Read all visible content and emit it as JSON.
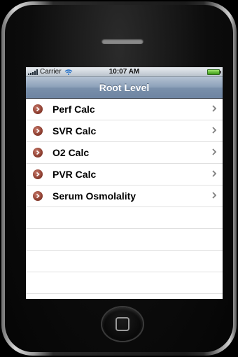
{
  "status_bar": {
    "carrier": "Carrier",
    "time": "10:07 AM"
  },
  "nav": {
    "title": "Root Level"
  },
  "items": [
    {
      "label": "Perf Calc"
    },
    {
      "label": "SVR Calc"
    },
    {
      "label": "O2 Calc"
    },
    {
      "label": "PVR Calc"
    },
    {
      "label": "Serum Osmolality"
    }
  ],
  "colors": {
    "nav_bar": "#7a90ab",
    "row_icon": "#8e3f31",
    "battery": "#3d9b18"
  },
  "icons": {
    "row_icon": "disclosure-circle-icon",
    "chevron": "chevron-right-icon",
    "wifi": "wifi-icon",
    "signal": "signal-bars-icon",
    "battery": "battery-icon"
  }
}
